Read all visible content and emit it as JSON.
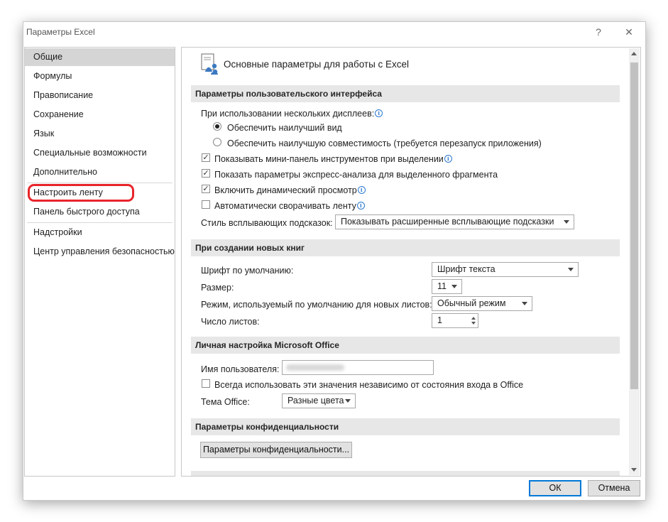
{
  "window": {
    "title": "Параметры Excel",
    "help_glyph": "?",
    "close_glyph": "✕"
  },
  "sidebar": {
    "items": [
      {
        "label": "Общие",
        "selected": true
      },
      {
        "label": "Формулы"
      },
      {
        "label": "Правописание"
      },
      {
        "label": "Сохранение"
      },
      {
        "label": "Язык"
      },
      {
        "label": "Специальные возможности"
      },
      {
        "label": "Дополнительно"
      },
      {
        "label": "Настроить ленту",
        "highlighted": true
      },
      {
        "label": "Панель быстрого доступа"
      },
      {
        "label": "Надстройки"
      },
      {
        "label": "Центр управления безопасностью"
      }
    ]
  },
  "main": {
    "header": "Основные параметры для работы с Excel",
    "ui_section": {
      "title": "Параметры пользовательского интерфейса",
      "multi_display_label": "При использовании нескольких дисплеев:",
      "radio_best_look": {
        "label": "Обеспечить наилучший вид",
        "checked": true
      },
      "radio_best_compat": {
        "label": "Обеспечить наилучшую совместимость (требуется перезапуск приложения)",
        "checked": false
      },
      "chk_mini_toolbar": {
        "label": "Показывать мини-панель инструментов при выделении",
        "checked": true
      },
      "chk_quick_analysis": {
        "label": "Показать параметры экспресс-анализа для выделенного фрагмента",
        "checked": true
      },
      "chk_live_preview": {
        "label": "Включить динамический просмотр",
        "checked": true
      },
      "chk_collapse_ribbon": {
        "label": "Автоматически сворачивать ленту",
        "checked": false
      },
      "tooltip_style_label": "Стиль всплывающих подсказок:",
      "tooltip_style_value": "Показывать расширенные всплывающие подсказки"
    },
    "new_workbooks": {
      "title": "При создании новых книг",
      "font_label": "Шрифт по умолчанию:",
      "font_value": "Шрифт текста",
      "size_label": "Размер:",
      "size_value": "11",
      "view_label": "Режим, используемый по умолчанию для новых листов:",
      "view_value": "Обычный режим",
      "sheets_label": "Число листов:",
      "sheets_value": "1"
    },
    "personalize": {
      "title": "Личная настройка Microsoft Office",
      "username_label": "Имя пользователя:",
      "always_use_label": "Всегда использовать эти значения независимо от состояния входа в Office",
      "always_use_checked": false,
      "theme_label": "Тема Office:",
      "theme_value": "Разные цвета"
    },
    "privacy": {
      "title": "Параметры конфиденциальности",
      "button": "Параметры конфиденциальности..."
    }
  },
  "footer": {
    "ok": "ОК",
    "cancel": "Отмена"
  }
}
